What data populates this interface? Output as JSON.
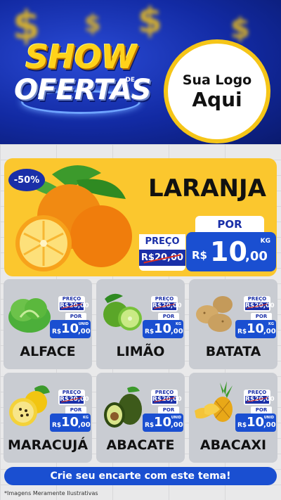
{
  "header": {
    "logo_line1": "SHOW",
    "logo_de": "DE",
    "logo_line2": "OFERTAS",
    "brand_line1": "Sua Logo",
    "brand_line2": "Aqui"
  },
  "featured": {
    "discount": "-50%",
    "name": "LARANJA",
    "price_label": "PREÇO",
    "old_price": "R$20,00",
    "por_label": "POR",
    "currency": "R$",
    "price_int": "10",
    "price_dec": ",00",
    "unit": "KG"
  },
  "products": [
    {
      "name": "ALFACE",
      "price_label": "PREÇO",
      "old_price": "R$20,00",
      "por_label": "POR",
      "currency": "R$",
      "price_int": "10",
      "price_dec": ",00",
      "unit": "UNID"
    },
    {
      "name": "LIMÃO",
      "price_label": "PREÇO",
      "old_price": "R$20,00",
      "por_label": "POR",
      "currency": "R$",
      "price_int": "10",
      "price_dec": ",00",
      "unit": "KG"
    },
    {
      "name": "BATATA",
      "price_label": "PREÇO",
      "old_price": "R$20,00",
      "por_label": "POR",
      "currency": "R$",
      "price_int": "10",
      "price_dec": ",00",
      "unit": "KG"
    },
    {
      "name": "MARACUJÁ",
      "price_label": "PREÇO",
      "old_price": "R$20,00",
      "por_label": "POR",
      "currency": "R$",
      "price_int": "10",
      "price_dec": ",00",
      "unit": "KG"
    },
    {
      "name": "ABACATE",
      "price_label": "PREÇO",
      "old_price": "R$20,00",
      "por_label": "POR",
      "currency": "R$",
      "price_int": "10",
      "price_dec": ",00",
      "unit": "UNID"
    },
    {
      "name": "ABACAXI",
      "price_label": "PREÇO",
      "old_price": "R$20,00",
      "por_label": "POR",
      "currency": "R$",
      "price_int": "10",
      "price_dec": ",00",
      "unit": "UNID"
    }
  ],
  "footer": {
    "cta": "Crie seu encarte com este tema!",
    "disclaimer": "*Imagens Meramente Ilustrativas"
  },
  "colors": {
    "header_blue": "#122aa3",
    "accent_yellow": "#fbc72e",
    "price_blue": "#1a4fd1",
    "card_gray": "#c9ccd2"
  },
  "icons": [
    "dollar-coin-icon",
    "orange-image",
    "lettuce-image",
    "lime-image",
    "potato-image",
    "passion-fruit-image",
    "avocado-image",
    "pineapple-image"
  ]
}
